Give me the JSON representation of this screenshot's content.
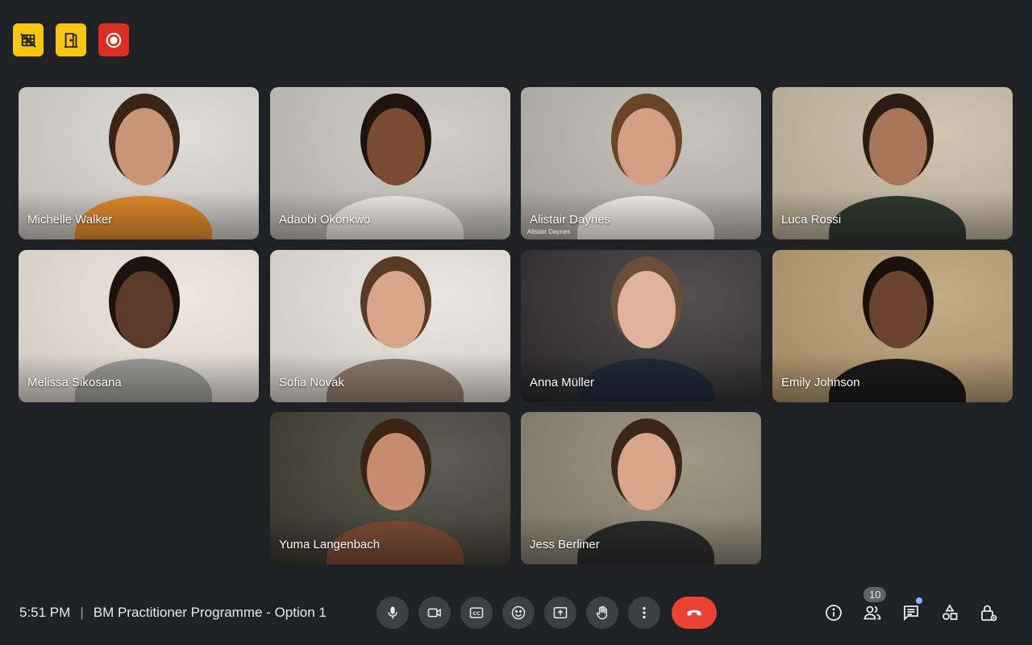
{
  "top_indicators": [
    {
      "icon": "no-video-grid-icon",
      "color": "#f9c513"
    },
    {
      "icon": "door-icon",
      "color": "#f9c513"
    },
    {
      "icon": "record-icon",
      "color": "#d93025"
    }
  ],
  "participants": [
    {
      "name": "Michelle Walker",
      "bg": "#d9d4cf",
      "skin": "#c89577",
      "hair": "#3a2418",
      "shirt": "#e08a2c"
    },
    {
      "name": "Adaobi Okonkwo",
      "bg": "#c7c4be",
      "skin": "#7a4a33",
      "hair": "#1e120c",
      "shirt": "#e9e7e3"
    },
    {
      "name": "Alistair Daynes",
      "bg": "#b9b6ae",
      "skin": "#d39e83",
      "hair": "#6b4428",
      "shirt": "#efece6",
      "watermark": "Alistair Daynes"
    },
    {
      "name": "Luca Rossi",
      "bg": "#c6b89f",
      "skin": "#a8765a",
      "hair": "#2b1d14",
      "shirt": "#2f3a30"
    },
    {
      "name": "Melissa Sikosana",
      "bg": "#ebe3d9",
      "skin": "#5b3a2a",
      "hair": "#1c120d",
      "shirt": "#9a9a98"
    },
    {
      "name": "Sofia Novak",
      "bg": "#e6e1da",
      "skin": "#d7a68b",
      "hair": "#5a3a24",
      "shirt": "#8d7b6c"
    },
    {
      "name": "Anna Müller",
      "bg": "#2c2a2b",
      "skin": "#e0b39a",
      "hair": "#6a4e3a",
      "shirt": "#1e2a3a"
    },
    {
      "name": "Emily Johnson",
      "bg": "#b59a6e",
      "skin": "#6b4330",
      "hair": "#1b110c",
      "shirt": "#1a1a1a"
    },
    {
      "name": "Yuma Langenbach",
      "bg": "#3a3a2e",
      "skin": "#c68c6e",
      "hair": "#3b2315",
      "shirt": "#7a4a34"
    },
    {
      "name": "Jess Berliner",
      "bg": "#8a8270",
      "skin": "#d8a58a",
      "hair": "#3a261a",
      "shirt": "#2a2a2a"
    }
  ],
  "meeting": {
    "time": "5:51 PM",
    "separator": "|",
    "title": "BM Practitioner Programme - Option 1"
  },
  "controls": [
    {
      "name": "microphone-button",
      "icon": "microphone-icon"
    },
    {
      "name": "camera-button",
      "icon": "camera-icon"
    },
    {
      "name": "captions-button",
      "icon": "closed-captions-icon"
    },
    {
      "name": "reactions-button",
      "icon": "emoji-icon"
    },
    {
      "name": "present-button",
      "icon": "present-screen-icon"
    },
    {
      "name": "raise-hand-button",
      "icon": "raise-hand-icon"
    },
    {
      "name": "more-options-button",
      "icon": "more-vertical-icon"
    },
    {
      "name": "leave-call-button",
      "icon": "end-call-icon",
      "color": "#ea4335"
    }
  ],
  "right_tools": {
    "people_count": "10",
    "items": [
      "info-icon",
      "people-icon",
      "chat-icon",
      "activities-icon",
      "host-controls-icon"
    ]
  }
}
